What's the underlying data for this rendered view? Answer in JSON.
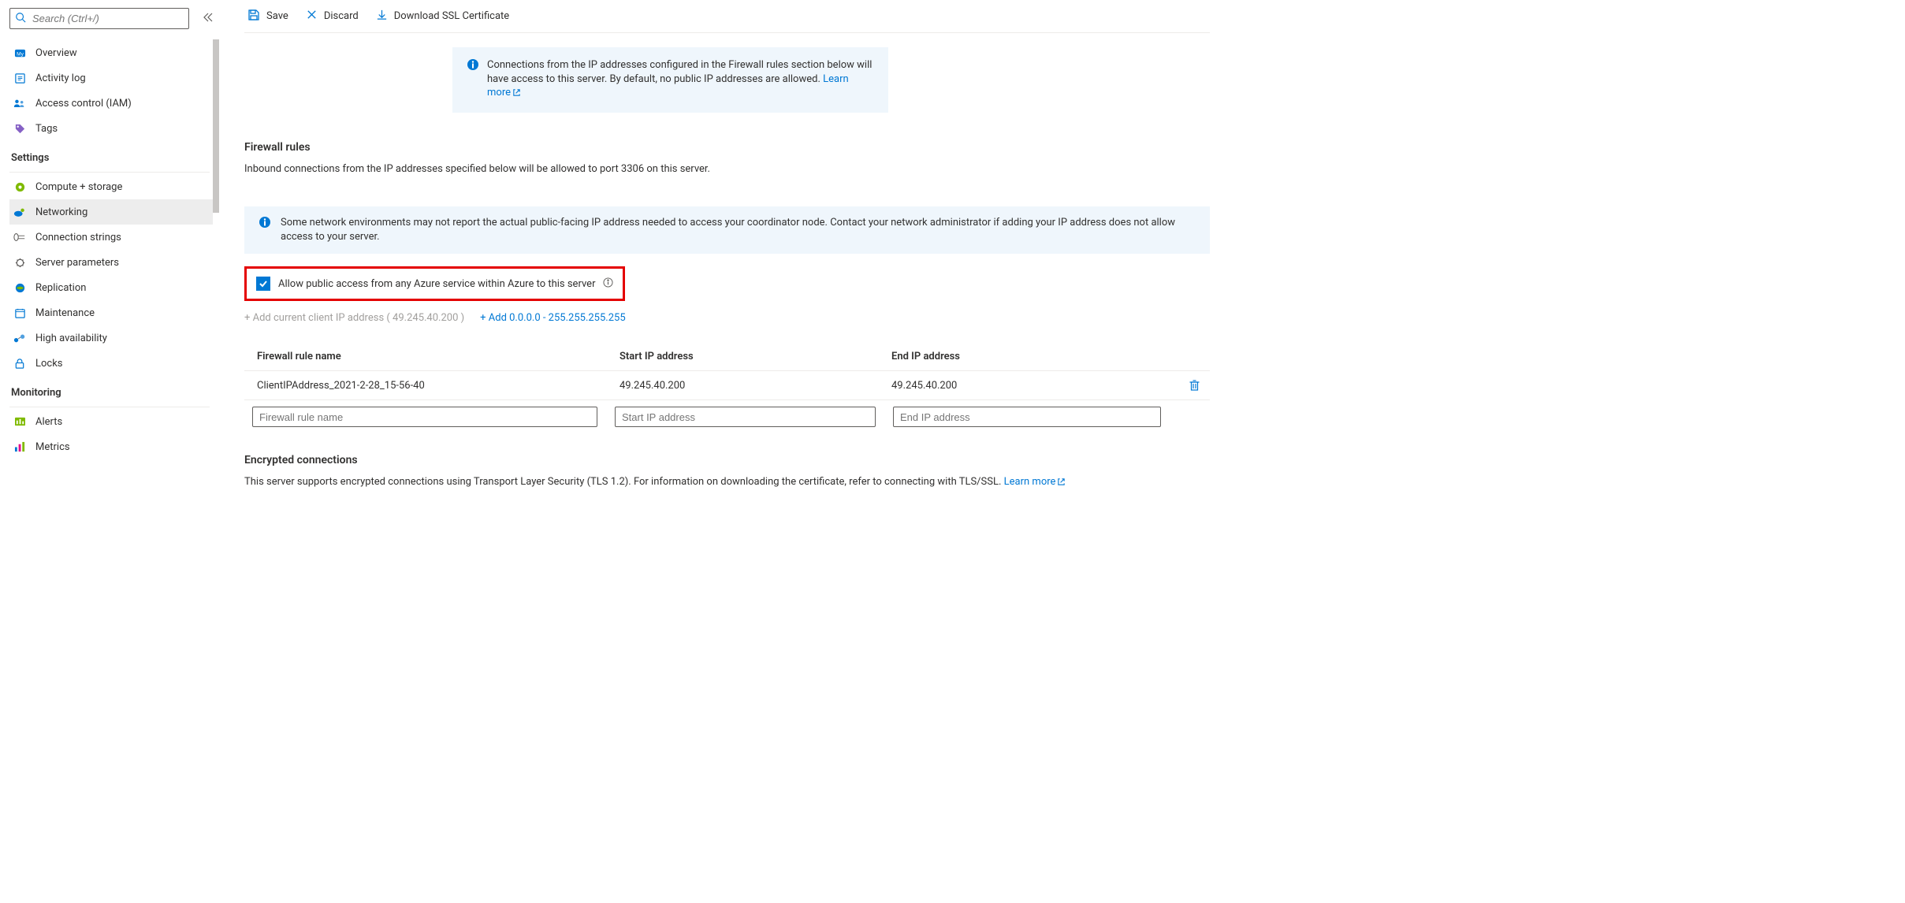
{
  "search": {
    "placeholder": "Search (Ctrl+/)"
  },
  "sidebar": {
    "top": [
      {
        "label": "Overview"
      },
      {
        "label": "Activity log"
      },
      {
        "label": "Access control (IAM)"
      },
      {
        "label": "Tags"
      }
    ],
    "sections": [
      {
        "title": "Settings",
        "items": [
          {
            "label": "Compute + storage"
          },
          {
            "label": "Networking"
          },
          {
            "label": "Connection strings"
          },
          {
            "label": "Server parameters"
          },
          {
            "label": "Replication"
          },
          {
            "label": "Maintenance"
          },
          {
            "label": "High availability"
          },
          {
            "label": "Locks"
          }
        ]
      },
      {
        "title": "Monitoring",
        "items": [
          {
            "label": "Alerts"
          },
          {
            "label": "Metrics"
          }
        ]
      }
    ]
  },
  "toolbar": {
    "save": "Save",
    "discard": "Discard",
    "download": "Download SSL Certificate"
  },
  "banner1": {
    "text": "Connections from the IP addresses configured in the Firewall rules section below will have access to this server. By default, no public IP addresses are allowed. ",
    "link": "Learn more"
  },
  "firewall": {
    "title": "Firewall rules",
    "desc": "Inbound connections from the IP addresses specified below will be allowed to port 3306 on this server."
  },
  "banner2": {
    "text": "Some network environments may not report the actual public-facing IP address needed to access your coordinator node. Contact your network administrator if adding your IP address does not allow access to your server."
  },
  "allow_azure": {
    "label": "Allow public access from any Azure service within Azure to this server"
  },
  "add_links": {
    "client": "+ Add current client IP address ( 49.245.40.200 )",
    "all": "+ Add 0.0.0.0 - 255.255.255.255"
  },
  "table": {
    "headers": {
      "name": "Firewall rule name",
      "start": "Start IP address",
      "end": "End IP address"
    },
    "rows": [
      {
        "name": "ClientIPAddress_2021-2-28_15-56-40",
        "start": "49.245.40.200",
        "end": "49.245.40.200"
      }
    ],
    "placeholders": {
      "name": "Firewall rule name",
      "start": "Start IP address",
      "end": "End IP address"
    }
  },
  "encrypted": {
    "title": "Encrypted connections",
    "text": "This server supports encrypted connections using Transport Layer Security (TLS 1.2). For information on downloading the certificate, refer to connecting with TLS/SSL. ",
    "link": "Learn more"
  }
}
